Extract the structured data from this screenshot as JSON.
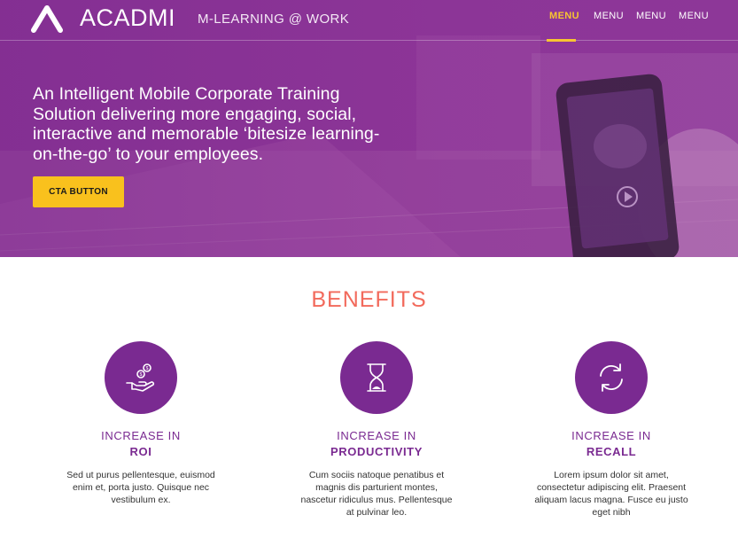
{
  "brand": {
    "logo_text": "ACADMI",
    "tagline": "M-LEARNING @ WORK",
    "logo_icon": "acadmi-a-logo-icon"
  },
  "nav": {
    "items": [
      {
        "label": "MENU",
        "active": true
      },
      {
        "label": "MENU",
        "active": false
      },
      {
        "label": "MENU",
        "active": false
      },
      {
        "label": "MENU",
        "active": false
      }
    ]
  },
  "hero": {
    "headline": "An Intelligent Mobile Corporate Training Solution delivering more engaging, social, interactive and memorable ‘bitesize learning-on-the-go’ to your employees.",
    "cta_label": "CTA BUTTON"
  },
  "benefits": {
    "title": "BENEFITS",
    "items": [
      {
        "icon": "money-hand-icon",
        "line1": "INCREASE IN",
        "line2": "ROI",
        "description": "Sed ut purus pellentesque, euismod enim et, porta justo. Quisque nec vestibulum ex."
      },
      {
        "icon": "hourglass-icon",
        "line1": "INCREASE IN",
        "line2": "PRODUCTIVITY",
        "description": "Cum sociis natoque penatibus et magnis dis parturient montes, nascetur ridiculus mus. Pellentesque at pulvinar leo."
      },
      {
        "icon": "refresh-icon",
        "line1": "INCREASE IN",
        "line2": "RECALL",
        "description": "Lorem ipsum dolor sit amet, consectetur adipiscing elit. Praesent aliquam lacus magna. Fusce eu justo eget nibh"
      }
    ]
  },
  "colors": {
    "brand_purple": "#7a2a91",
    "accent_yellow": "#f9c11d",
    "benefits_title": "#f26a5c"
  }
}
